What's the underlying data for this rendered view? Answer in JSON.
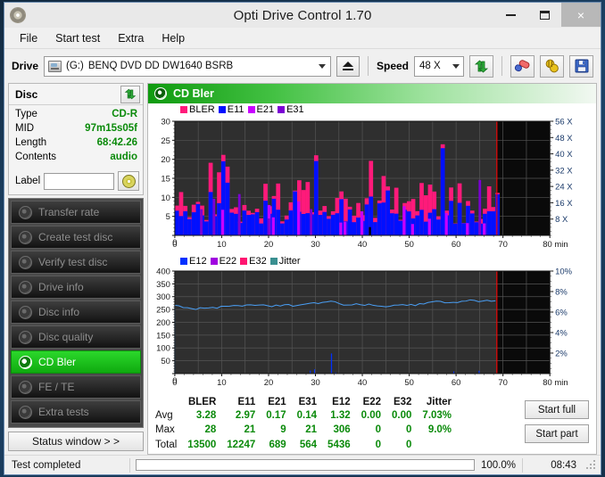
{
  "window": {
    "title": "Opti Drive Control 1.70",
    "app_icon": "disc-icon",
    "minimize_label": "",
    "maximize_label": "",
    "close_label": "×"
  },
  "menu": [
    {
      "label": "File"
    },
    {
      "label": "Start test"
    },
    {
      "label": "Extra"
    },
    {
      "label": "Help"
    }
  ],
  "toolbar": {
    "drive_label": "Drive",
    "drive_letter": "(G:)",
    "drive_name": "BENQ DVD DD DW1640 BSRB",
    "eject_icon": "eject-icon",
    "speed_label": "Speed",
    "speed_value": "48 X",
    "refresh_icon": "refresh-icon",
    "erase_icon": "eraser-icon",
    "plug_icon": "plug-icon",
    "save_icon": "save-icon"
  },
  "disc": {
    "panel_title": "Disc",
    "refresh_icon": "refresh-icon",
    "rows": [
      {
        "key": "Type",
        "value": "CD-R"
      },
      {
        "key": "MID",
        "value": "97m15s05f"
      },
      {
        "key": "Length",
        "value": "68:42.26"
      },
      {
        "key": "Contents",
        "value": "audio"
      }
    ],
    "label_key": "Label",
    "label_value": "",
    "label_placeholder": "",
    "label_disc_icon": "cd-icon"
  },
  "nav": {
    "items": [
      {
        "label": "Transfer rate",
        "active": false
      },
      {
        "label": "Create test disc",
        "active": false
      },
      {
        "label": "Verify test disc",
        "active": false
      },
      {
        "label": "Drive info",
        "active": false
      },
      {
        "label": "Disc info",
        "active": false
      },
      {
        "label": "Disc quality",
        "active": false
      },
      {
        "label": "CD Bler",
        "active": true
      },
      {
        "label": "FE / TE",
        "active": false
      },
      {
        "label": "Extra tests",
        "active": false
      }
    ],
    "status_window_label": "Status window > >"
  },
  "main": {
    "header_title": "CD Bler",
    "header_icon": "disc-icon"
  },
  "chart_data": [
    {
      "type": "line",
      "id": "bler-chart",
      "title": "CD Bler",
      "xlabel": "min",
      "ylabel": "",
      "xlim": [
        0,
        80
      ],
      "ylim": [
        0,
        30
      ],
      "xticks": [
        0,
        10,
        20,
        30,
        40,
        50,
        60,
        70,
        80
      ],
      "xticklabels": [
        "0",
        "10",
        "20",
        "30",
        "40",
        "50",
        "60",
        "70",
        "80 min"
      ],
      "yticks": [
        0,
        5,
        10,
        15,
        20,
        25,
        30
      ],
      "yticklabels": [
        "0",
        "5",
        "10",
        "15",
        "20",
        "25",
        "30"
      ],
      "right_axis": {
        "label": "X",
        "ticks": [
          8,
          16,
          24,
          32,
          40,
          48,
          56
        ],
        "ticklabels": [
          "8 X",
          "16 X",
          "24 X",
          "32 X",
          "40 X",
          "48 X",
          "56 X"
        ],
        "lim": [
          0,
          56
        ]
      },
      "grid": true,
      "background": "#2e2e2e",
      "legend_position": "top-left",
      "data_end_x": 68.7,
      "end_marker_x": 68.7,
      "end_marker_color": "#ff0000",
      "series": [
        {
          "name": "BLER",
          "color": "#ff1a7a",
          "avg": 3.28,
          "max": 28,
          "total": 13500
        },
        {
          "name": "E11",
          "color": "#0010ff",
          "avg": 2.97,
          "max": 21,
          "total": 12247
        },
        {
          "name": "E21",
          "color": "#c800ff",
          "avg": 0.17,
          "max": 9,
          "total": 689
        },
        {
          "name": "E31",
          "color": "#7b00d4",
          "avg": 0.14,
          "max": 21,
          "total": 564
        }
      ]
    },
    {
      "type": "line",
      "id": "e12-jitter-chart",
      "title": "",
      "xlabel": "min",
      "ylabel": "",
      "xlim": [
        0,
        80
      ],
      "ylim": [
        0,
        400
      ],
      "xticks": [
        0,
        10,
        20,
        30,
        40,
        50,
        60,
        70,
        80
      ],
      "xticklabels": [
        "0",
        "10",
        "20",
        "30",
        "40",
        "50",
        "60",
        "70",
        "80 min"
      ],
      "yticks": [
        0,
        50,
        100,
        150,
        200,
        250,
        300,
        350,
        400
      ],
      "yticklabels": [
        "0",
        "50",
        "100",
        "150",
        "200",
        "250",
        "300",
        "350",
        "400"
      ],
      "right_axis": {
        "label": "%",
        "ticks": [
          2,
          4,
          6,
          8,
          10
        ],
        "ticklabels": [
          "2%",
          "4%",
          "6%",
          "8%",
          "10%"
        ],
        "lim": [
          0,
          10
        ]
      },
      "grid": true,
      "background": "#2e2e2e",
      "legend_position": "top-left",
      "data_end_x": 68.7,
      "end_marker_x": 68.7,
      "end_marker_color": "#ff0000",
      "jitter_mean_pct": 7.03,
      "series": [
        {
          "name": "E12",
          "color": "#0030ff",
          "avg": 1.32,
          "max": 306,
          "total": 5436
        },
        {
          "name": "E22",
          "color": "#a000e0",
          "avg": 0.0,
          "max": 0,
          "total": 0
        },
        {
          "name": "E32",
          "color": "#ff1470",
          "avg": 0.0,
          "max": 0,
          "total": 0
        },
        {
          "name": "Jitter",
          "color": "#3a8f90",
          "avg": "7.03%",
          "max": "9.0%",
          "total": ""
        }
      ]
    }
  ],
  "stats": {
    "columns": [
      "BLER",
      "E11",
      "E21",
      "E31",
      "E12",
      "E22",
      "E32",
      "Jitter"
    ],
    "rows": [
      {
        "label": "Avg",
        "values": [
          "3.28",
          "2.97",
          "0.17",
          "0.14",
          "1.32",
          "0.00",
          "0.00",
          "7.03%"
        ]
      },
      {
        "label": "Max",
        "values": [
          "28",
          "21",
          "9",
          "21",
          "306",
          "0",
          "0",
          "9.0%"
        ]
      },
      {
        "label": "Total",
        "values": [
          "13500",
          "12247",
          "689",
          "564",
          "5436",
          "0",
          "0",
          ""
        ]
      }
    ]
  },
  "actions": {
    "start_full_label": "Start full",
    "start_part_label": "Start part"
  },
  "statusbar": {
    "text": "Test completed",
    "progress_percent": 100.0,
    "progress_label": "100.0%",
    "elapsed_time": "08:43"
  }
}
